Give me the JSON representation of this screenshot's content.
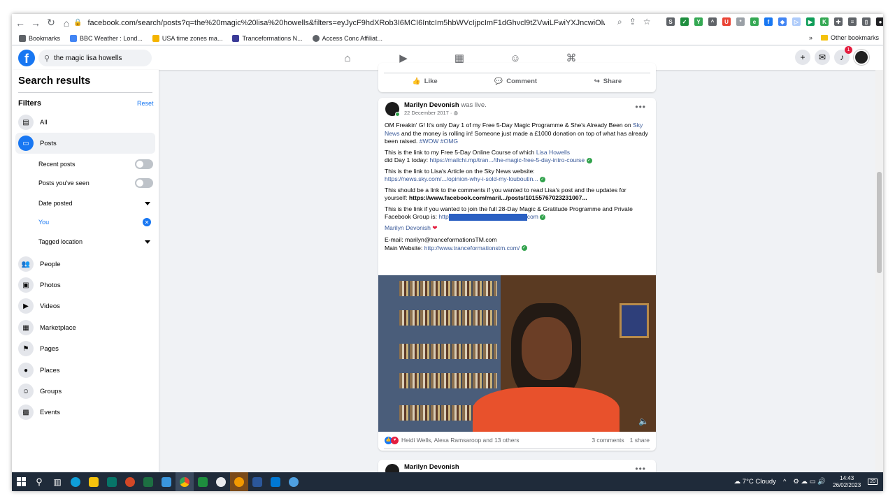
{
  "browser": {
    "url": "facebook.com/search/posts?q=the%20magic%20lisa%20howells&filters=eyJycF9hdXRob3I6MCI6IntcIm5hbWVcIjpcImF1dGhvcl9tZVwiLFwiYXJncwiOlwiXCJ9In0%3D",
    "bookmarks": [
      {
        "label": "Bookmarks",
        "color": "#5f6368"
      },
      {
        "label": "BBC Weather : Lond...",
        "color": "#4285f4"
      },
      {
        "label": "USA time zones ma...",
        "color": "#f4b400"
      },
      {
        "label": "Tranceformations N...",
        "color": "#3b3b98"
      },
      {
        "label": "Access Conc Affiliat...",
        "color": "#5f6368"
      }
    ],
    "more_bookmarks": "»",
    "other_bookmarks": "Other bookmarks"
  },
  "fb": {
    "search_value": "the magic lisa howells",
    "notification_count": "1"
  },
  "sidebar": {
    "title": "Search results",
    "filters_label": "Filters",
    "reset_label": "Reset",
    "all_label": "All",
    "posts_label": "Posts",
    "sub": {
      "recent": "Recent posts",
      "seen": "Posts you've seen",
      "date": "Date posted",
      "you": "You",
      "tagged": "Tagged location"
    },
    "items": [
      {
        "label": "People",
        "icon": "people-icon"
      },
      {
        "label": "Photos",
        "icon": "photos-icon"
      },
      {
        "label": "Videos",
        "icon": "videos-icon"
      },
      {
        "label": "Marketplace",
        "icon": "marketplace-icon"
      },
      {
        "label": "Pages",
        "icon": "pages-icon"
      },
      {
        "label": "Places",
        "icon": "places-icon"
      },
      {
        "label": "Groups",
        "icon": "groups-icon"
      },
      {
        "label": "Events",
        "icon": "events-icon"
      }
    ]
  },
  "actions": {
    "like": "Like",
    "comment": "Comment",
    "share": "Share"
  },
  "post": {
    "author": "Marilyn Devonish",
    "was_live": "was live.",
    "date": "22 December 2017 ·",
    "p1_a": "OM Freakin' G!  It's only Day 1 of my Free 5-Day Magic Programme & She's Already Been on",
    "p1_link": "Sky News",
    "p1_b": "and the money is rolling in!  Someone just made a £1000 donation on top of what has already been raised.",
    "p1_tags": "#WOW #OMG",
    "p2_a": "This is the link to my Free 5-Day Online Course of which",
    "p2_link": "Lisa Howells",
    "p2_b": "did Day 1 today:",
    "p2_url": "https://mailchi.mp/tran.../the-magic-free-5-day-intro-course",
    "p3_a": "This is the link to Lisa's Article on the Sky News website:",
    "p3_url": "https://news.sky.com/.../opinion-why-i-sold-my-louboutin...",
    "p4_a": "This should be a link to the comments if you wanted to read Lisa's post and the updates for yourself:",
    "p4_url": "https://www.facebook.com/maril.../posts/10155767023231007...",
    "p5_a": "This is the link if you wanted to join the full 28-Day Magic & Gratitude Programme and Private Facebook Group is:",
    "p5_url_a": "http",
    "p5_url_b": "com",
    "signature": "Marilyn Devonish",
    "email": "E-mail: marilyn@tranceformationsTM.com",
    "website_label": "Main Website:",
    "website_url": "http://www.tranceformationstm.com/",
    "reactions_names": "Heidi Wells, Alexa Ramsaroop and 13 others",
    "comments": "3 comments",
    "shares": "1 share"
  },
  "next_post": {
    "author": "Marilyn Devonish"
  },
  "taskbar": {
    "weather": "7°C  Cloudy",
    "time": "14:43",
    "date": "26/02/2023",
    "notif": "20"
  },
  "colors": {
    "fb_blue": "#1877f2",
    "link": "#385898",
    "online": "#31a24c"
  }
}
